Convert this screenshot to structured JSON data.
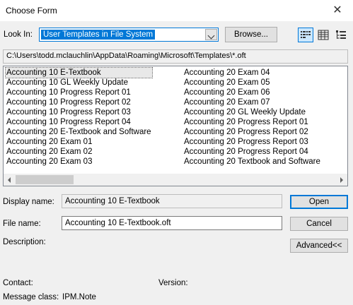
{
  "window": {
    "title": "Choose Form"
  },
  "look_in": {
    "label": "Look In:",
    "value": "User Templates in File System",
    "browse_label": "Browse..."
  },
  "path": "C:\\Users\\todd.mclauchlin\\AppData\\Roaming\\Microsoft\\Templates\\*.oft",
  "list": {
    "column1": [
      "Accounting 10 E-Textbook",
      "Accounting 10 GL Weekly Update",
      "Accounting 10 Progress Report 01",
      "Accounting 10 Progress Report 02",
      "Accounting 10 Progress Report 03",
      "Accounting 10 Progress Report 04",
      "Accounting 20 E-Textbook and Software",
      "Accounting 20 Exam 01",
      "Accounting 20 Exam 02",
      "Accounting 20 Exam 03"
    ],
    "column2": [
      "Accounting 20 Exam 04",
      "Accounting 20 Exam 05",
      "Accounting 20 Exam 06",
      "Accounting 20 Exam 07",
      "Accounting 20 GL Weekly Update",
      "Accounting 20 Progress Report 01",
      "Accounting 20 Progress Report 02",
      "Accounting 20 Progress Report 03",
      "Accounting 20 Progress Report 04",
      "Accounting 20 Textbook and Software"
    ],
    "selected_item": "Accounting 10 E-Textbook"
  },
  "display_name": {
    "label": "Display name:",
    "value": "Accounting 10 E-Textbook"
  },
  "file_name": {
    "label": "File name:",
    "value": "Accounting 10 E-Textbook.oft"
  },
  "description": {
    "label": "Description:"
  },
  "buttons": {
    "open": "Open",
    "cancel": "Cancel",
    "advanced": "Advanced<<"
  },
  "contact": {
    "label": "Contact:"
  },
  "version": {
    "label": "Version:"
  },
  "message_class": {
    "label": "Message class:",
    "value": "IPM.Note"
  },
  "icons": {
    "close": "close-icon",
    "dropdown": "chevron-down-icon",
    "list_view": "list-view-icon",
    "details_view": "details-view-icon",
    "properties_view": "properties-view-icon"
  },
  "colors": {
    "accent": "#0078d7",
    "selection_bg": "#0078d7",
    "dialog_bg": "#f0f0f0"
  }
}
